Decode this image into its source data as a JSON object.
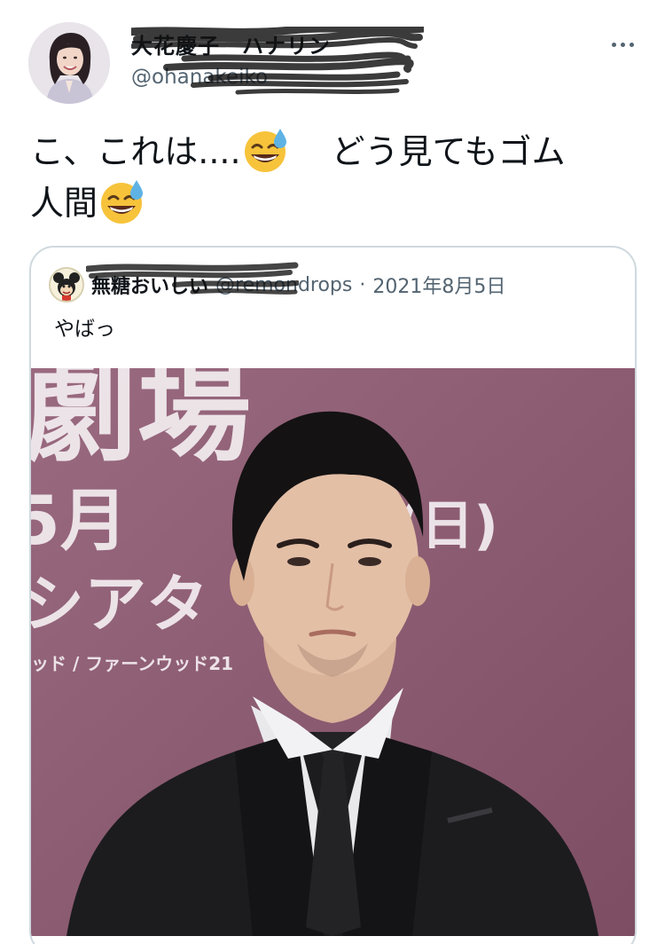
{
  "author": {
    "display_name": "大花慶子　ハナリン",
    "handle": "@ohanakeiko"
  },
  "tweet": {
    "text_part1": "こ、これは....",
    "text_part2": "どう見てもゴム",
    "text_part3": "人間"
  },
  "quoted": {
    "display_name": "無糖おいしい",
    "handle": "@remondrops",
    "separator": "·",
    "date": "2021年8月5日",
    "text": "やばっ"
  },
  "media_text": {
    "big_chars": "劇場",
    "date_line": "5月",
    "day": "(日)",
    "venue": "シアタ",
    "sponsors": "ッド / ファーンウッド21"
  },
  "icons": {
    "emoji": "grinning-sweat-emoji",
    "more": "more-options-icon"
  },
  "colors": {
    "text": "#0f1419",
    "secondary": "#536471",
    "border": "#cfd9de",
    "backdrop": "#8a5a6e"
  }
}
